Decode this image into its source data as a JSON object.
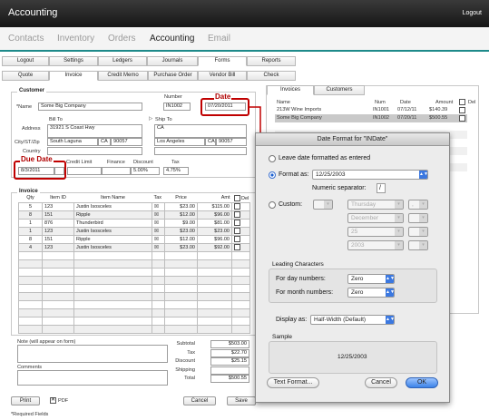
{
  "app": {
    "title": "Accounting",
    "logout": "Logout"
  },
  "nav": [
    "Contacts",
    "Inventory",
    "Orders",
    "Accounting",
    "Email"
  ],
  "tabs1": [
    "Logout",
    "Settings",
    "Ledgers",
    "Journals",
    "Forms",
    "Reports"
  ],
  "tabs2": [
    "Quote",
    "Invoice",
    "Credit Memo",
    "Purchase Order",
    "Vendor Bill",
    "Check"
  ],
  "customer": {
    "legend": "Customer",
    "number_label": "Number",
    "number": "IN1002",
    "name_label": "*Name",
    "name": "Some Big Company",
    "bill_to_label": "Bill To",
    "ship_to_label": "Ship To",
    "address_label": "Address",
    "bill_address": "31921 S Coast Hwy",
    "ship_address": "CA",
    "citystzip_label": "City/ST/Zip",
    "bill_city": "South Laguna",
    "bill_state": "CA",
    "bill_zip": "90057",
    "ship_city": "Los Angeles",
    "ship_state": "CA",
    "ship_zip": "90057",
    "country_label": "Country",
    "credit_limit_label": "Credit Limit",
    "finance_label": "Finance",
    "discount_label": "Discount",
    "tax_label": "Tax",
    "due_date": "8/3/2011",
    "discount": "5.00%",
    "tax": "4.75%"
  },
  "callouts": {
    "date_label": "Date",
    "date_value": "07/20/2011",
    "due_label": "Due Date"
  },
  "invoice": {
    "legend": "Invoice",
    "headers": [
      "Qty",
      "Item ID",
      "Item Name",
      "Tax",
      "Price",
      "Amt",
      "Del"
    ],
    "rows": [
      [
        "5",
        "123",
        "Justin Isosceles",
        "☒",
        "$23.00",
        "$115.00"
      ],
      [
        "8",
        "151",
        "Ripple",
        "☒",
        "$12.00",
        "$96.00"
      ],
      [
        "1",
        "876",
        "Thunderbird",
        "☒",
        "$9.00",
        "$81.00"
      ],
      [
        "1",
        "123",
        "Justin Isosceles",
        "☒",
        "$23.00",
        "$23.00"
      ],
      [
        "8",
        "151",
        "Ripple",
        "☒",
        "$12.00",
        "$96.00"
      ],
      [
        "4",
        "123",
        "Justin Isosceles",
        "☒",
        "$23.00",
        "$92.00"
      ]
    ]
  },
  "notes": {
    "note_label": "Note (will appear on form)",
    "comments_label": "Comments"
  },
  "totals": {
    "subtotal_label": "Subtotal",
    "subtotal": "$503.00",
    "tax_label": "Tax",
    "tax": "$22.70",
    "discount_label": "Discount",
    "discount": "$25.15",
    "shipping_label": "Shipping",
    "shipping": "",
    "total_label": "Total",
    "total": "$500.55"
  },
  "footer": {
    "print": "Print",
    "pdf": "PDF",
    "cancel": "Cancel",
    "save": "Save",
    "required": "*Required Fields"
  },
  "right": {
    "tabs": [
      "Invoices",
      "Customers"
    ],
    "headers": [
      "Name",
      "Num",
      "Date",
      "Amount",
      "Del"
    ],
    "rows": [
      [
        "213W Wine Imports",
        "IN1001",
        "07/12/11",
        "$140.39"
      ],
      [
        "Some Big Company",
        "IN1002",
        "07/20/11",
        "$500.55"
      ]
    ]
  },
  "dialog": {
    "title": "Date Format for \"INDate\"",
    "leave_label": "Leave date formatted as entered",
    "format_label": "Format as:",
    "format_value": "12/25/2003",
    "numsep_label": "Numeric separator:",
    "numsep_value": "/",
    "custom_label": "Custom:",
    "custom_day": "Thursday",
    "custom_month": "December",
    "custom_date": "25",
    "custom_year": "2003",
    "custom_sep1": ",",
    "leading_title": "Leading Characters",
    "day_label": "For day numbers:",
    "day_value": "Zero",
    "month_label": "For month numbers:",
    "month_value": "Zero",
    "display_label": "Display as:",
    "display_value": "Half-Width (Default)",
    "sample_title": "Sample",
    "sample_value": "12/25/2003",
    "text_format": "Text Format...",
    "cancel": "Cancel",
    "ok": "OK"
  }
}
